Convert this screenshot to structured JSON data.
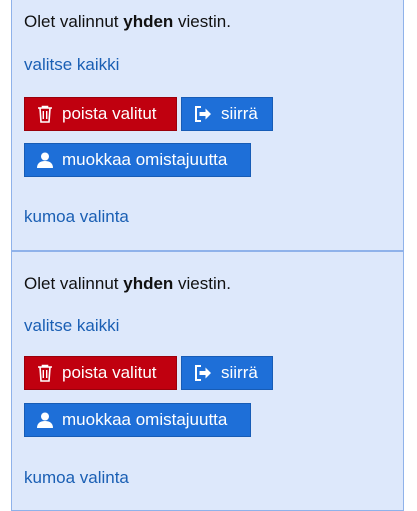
{
  "panels": [
    {
      "message": {
        "prefix": "Olet valinnut ",
        "bold": "yhden",
        "suffix": " viestin."
      },
      "select_all": "valitse kaikki",
      "delete_label": "poista valitut",
      "move_label": "siirrä",
      "edit_owner_label": "muokkaa omistajuutta",
      "undo_label": "kumoa valinta"
    },
    {
      "message": {
        "prefix": "Olet valinnut ",
        "bold": "yhden",
        "suffix": " viestin."
      },
      "select_all": "valitse kaikki",
      "delete_label": "poista valitut",
      "move_label": "siirrä",
      "edit_owner_label": "muokkaa omistajuutta",
      "undo_label": "kumoa valinta"
    }
  ],
  "colors": {
    "panel_bg": "#dde8fb",
    "panel_border": "#8fb2ea",
    "link": "#1a5fb4",
    "delete_button": "#c0000f",
    "primary_button": "#1e6fd8"
  },
  "icons": {
    "delete": "trash-icon",
    "move": "sign-out-icon",
    "edit_owner": "user-icon"
  }
}
